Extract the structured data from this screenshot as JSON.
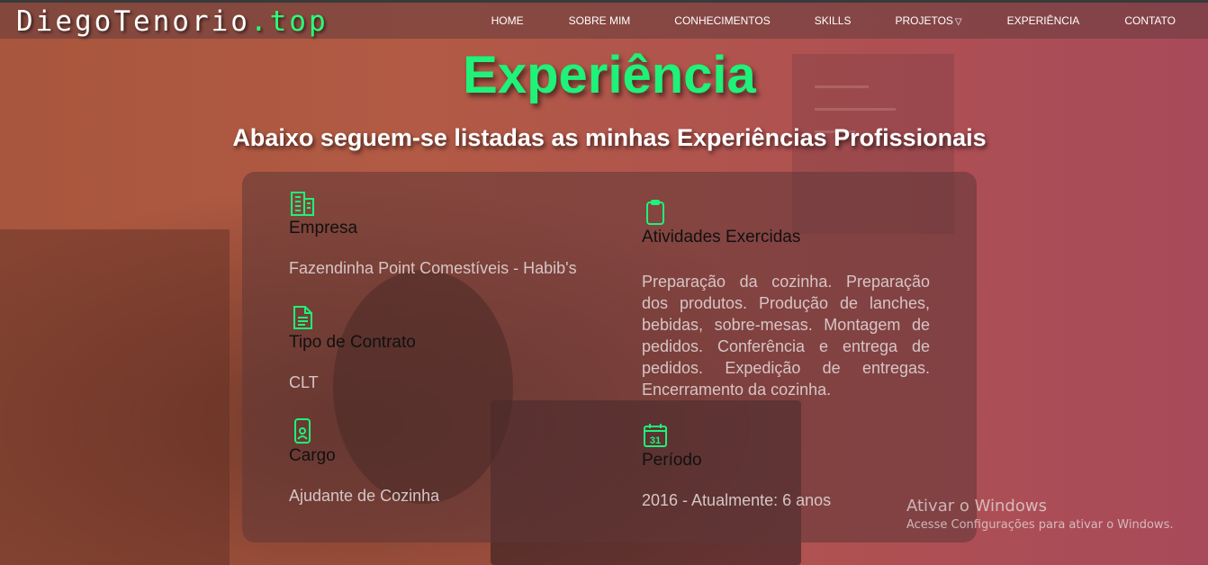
{
  "logo": {
    "name": "DiegoTenorio",
    "tld": ".top"
  },
  "nav": {
    "items": [
      "HOME",
      "SOBRE MIM",
      "CONHECIMENTOS",
      "SKILLS",
      "PROJETOS",
      "EXPERIÊNCIA",
      "CONTATO"
    ]
  },
  "page": {
    "title": "Experiência",
    "subtitle": "Abaixo seguem-se listadas as minhas Experiências Profissionais"
  },
  "experience": {
    "empresa": {
      "label": "Empresa",
      "value": "Fazendinha Point Comestíveis - Habib's",
      "icon": "building-icon"
    },
    "contrato": {
      "label": "Tipo de Contrato",
      "value": "CLT",
      "icon": "document-icon"
    },
    "cargo": {
      "label": "Cargo",
      "value": "Ajudante de Cozinha",
      "icon": "badge-icon"
    },
    "atividades": {
      "label": "Atividades Exercidas",
      "value": "Preparação da cozinha. Preparação dos produtos. Produção de lanches, bebidas, sobre-mesas. Montagem de pedidos. Conferência e entrega de pedidos. Expedição de entregas. Encerramento da cozinha.",
      "icon": "clipboard-icon"
    },
    "periodo": {
      "label": "Período",
      "value": "2016 - Atualmente: 6 anos",
      "icon": "calendar-icon",
      "calendar_day": "31"
    }
  },
  "watermark": {
    "title": "Ativar o Windows",
    "subtitle": "Acesse Configurações para ativar o Windows."
  },
  "colors": {
    "accent": "#1ef279",
    "label": "#111111",
    "value": "#d6c5c5"
  }
}
